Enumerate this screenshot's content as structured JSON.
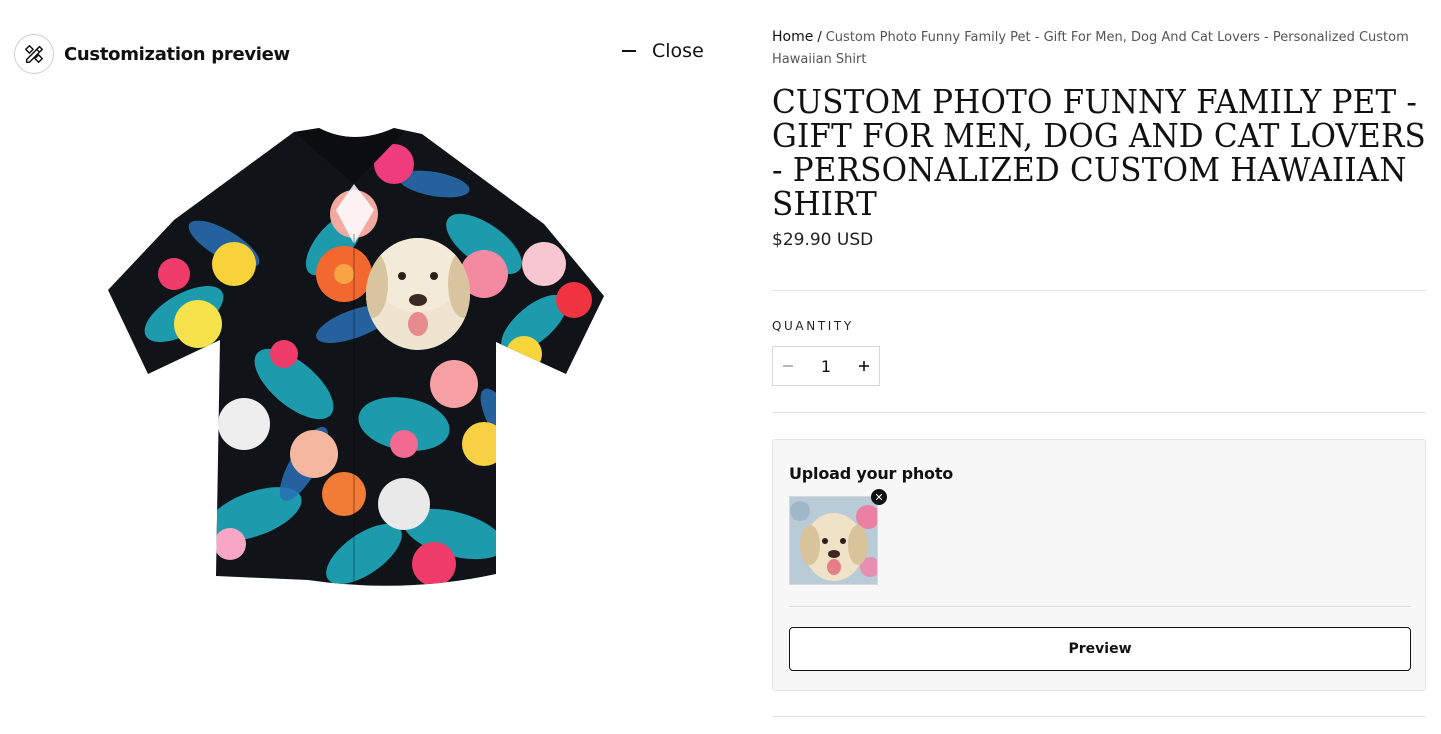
{
  "preview": {
    "title": "Customization preview",
    "close_label": "Close",
    "icon": "design-tools-icon"
  },
  "breadcrumb": {
    "home": "Home",
    "separator": "/",
    "current": "Custom Photo Funny Family Pet - Gift For Men, Dog And Cat Lovers - Personalized Custom Hawaiian Shirt"
  },
  "product": {
    "title": "Custom Photo Funny Family Pet - Gift For Men, Dog And Cat Lovers - Personalized Custom Hawaiian Shirt",
    "price": "$29.90 USD"
  },
  "quantity": {
    "label": "QUANTITY",
    "value": "1",
    "decrement_icon": "minus-icon",
    "increment_icon": "plus-icon"
  },
  "upload": {
    "title": "Upload your photo",
    "remove_icon": "close-icon",
    "preview_button": "Preview"
  },
  "colors": {
    "text": "#111111",
    "panel_bg": "#f7f7f7",
    "border": "#e2e2e2"
  }
}
